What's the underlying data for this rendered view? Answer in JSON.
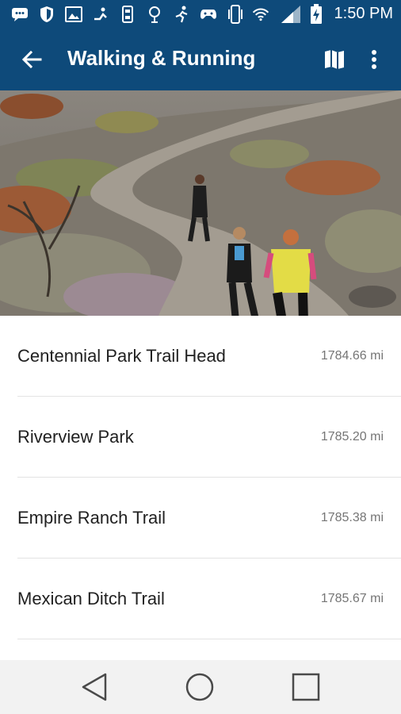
{
  "status_bar": {
    "time": "1:50 PM",
    "icons": [
      "messages-icon",
      "shield-icon",
      "gallery-icon",
      "running-icon",
      "hourglass-icon",
      "tree-icon",
      "runner-icon",
      "gamepad-icon",
      "vibrate-icon",
      "wifi-icon",
      "signal-icon",
      "battery-charging-icon"
    ]
  },
  "app_bar": {
    "title": "Walking & Running",
    "back_icon": "arrow-back-icon",
    "map_icon": "map-icon",
    "more_icon": "more-vert-icon"
  },
  "hero": {
    "image": "three women running on a desert dirt trail"
  },
  "trails": [
    {
      "name": "Centennial Park Trail Head",
      "distance": "1784.66 mi"
    },
    {
      "name": "Riverview Park",
      "distance": "1785.20 mi"
    },
    {
      "name": "Empire Ranch Trail",
      "distance": "1785.38 mi"
    },
    {
      "name": "Mexican Ditch Trail",
      "distance": "1785.67 mi"
    }
  ],
  "nav_bar": {
    "back": "nav-back-icon",
    "home": "nav-home-icon",
    "recents": "nav-recents-icon"
  },
  "colors": {
    "primary": "#0e4a7a",
    "text_primary": "#212121",
    "text_secondary": "#757575",
    "divider": "#e3e3e3",
    "nav_bar": "#f2f2f2"
  }
}
